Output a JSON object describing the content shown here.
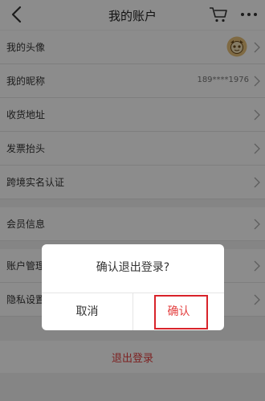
{
  "header": {
    "title": "我的账户",
    "back_icon": "chevron-left-icon",
    "cart_icon": "cart-icon",
    "more_icon": "more-icon"
  },
  "rows": [
    {
      "label": "我的头像",
      "value": ""
    },
    {
      "label": "我的昵称",
      "value": "189****1976"
    },
    {
      "label": "收货地址",
      "value": ""
    },
    {
      "label": "发票抬头",
      "value": ""
    },
    {
      "label": "跨境实名认证",
      "value": ""
    },
    {
      "label": "会员信息",
      "value": ""
    },
    {
      "label": "账户管理",
      "value": ""
    },
    {
      "label": "隐私设置",
      "value": ""
    }
  ],
  "logout": {
    "label": "退出登录"
  },
  "dialog": {
    "message": "确认退出登录?",
    "cancel": "取消",
    "confirm": "确认"
  },
  "colors": {
    "accent": "#e33f3f",
    "highlight": "#d8232a",
    "background": "#f2f2f2"
  }
}
